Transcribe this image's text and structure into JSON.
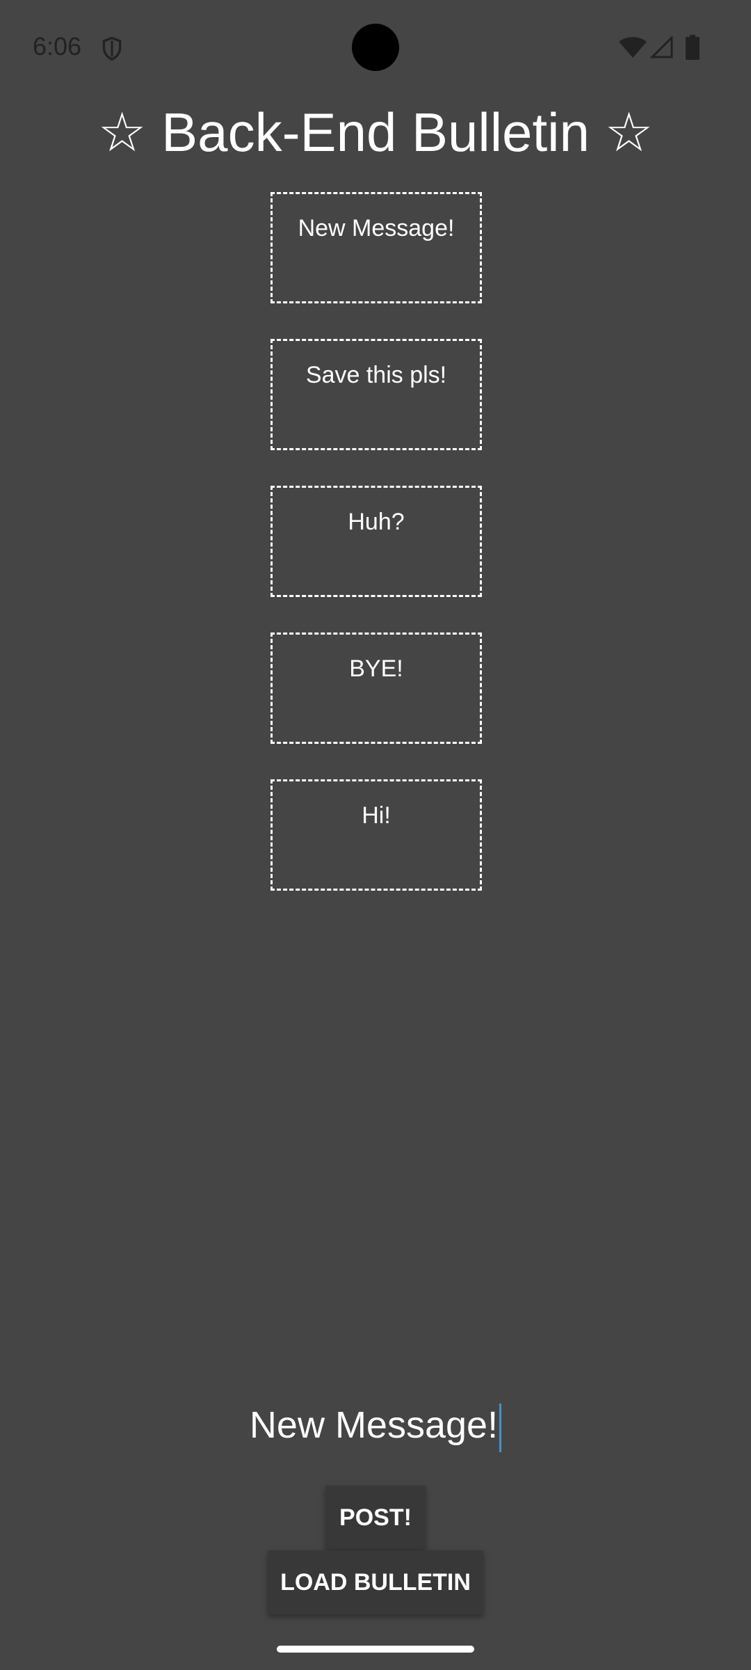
{
  "status_bar": {
    "time": "6:06",
    "icons": [
      "shield-icon",
      "wifi-icon",
      "cellular-signal-icon",
      "battery-icon"
    ]
  },
  "app": {
    "title": "☆ Back-End Bulletin ☆",
    "background_color": "#454545",
    "text_color": "#ffffff"
  },
  "messages": [
    {
      "text": "New Message!"
    },
    {
      "text": "Save this pls!"
    },
    {
      "text": "Huh?"
    },
    {
      "text": "BYE!"
    },
    {
      "text": "Hi!"
    }
  ],
  "composer": {
    "value": "New Message!",
    "cursor_color": "#4a90c8"
  },
  "buttons": {
    "post_label": "POST!",
    "load_label": "LOAD BULLETIN",
    "button_color": "#383838"
  }
}
